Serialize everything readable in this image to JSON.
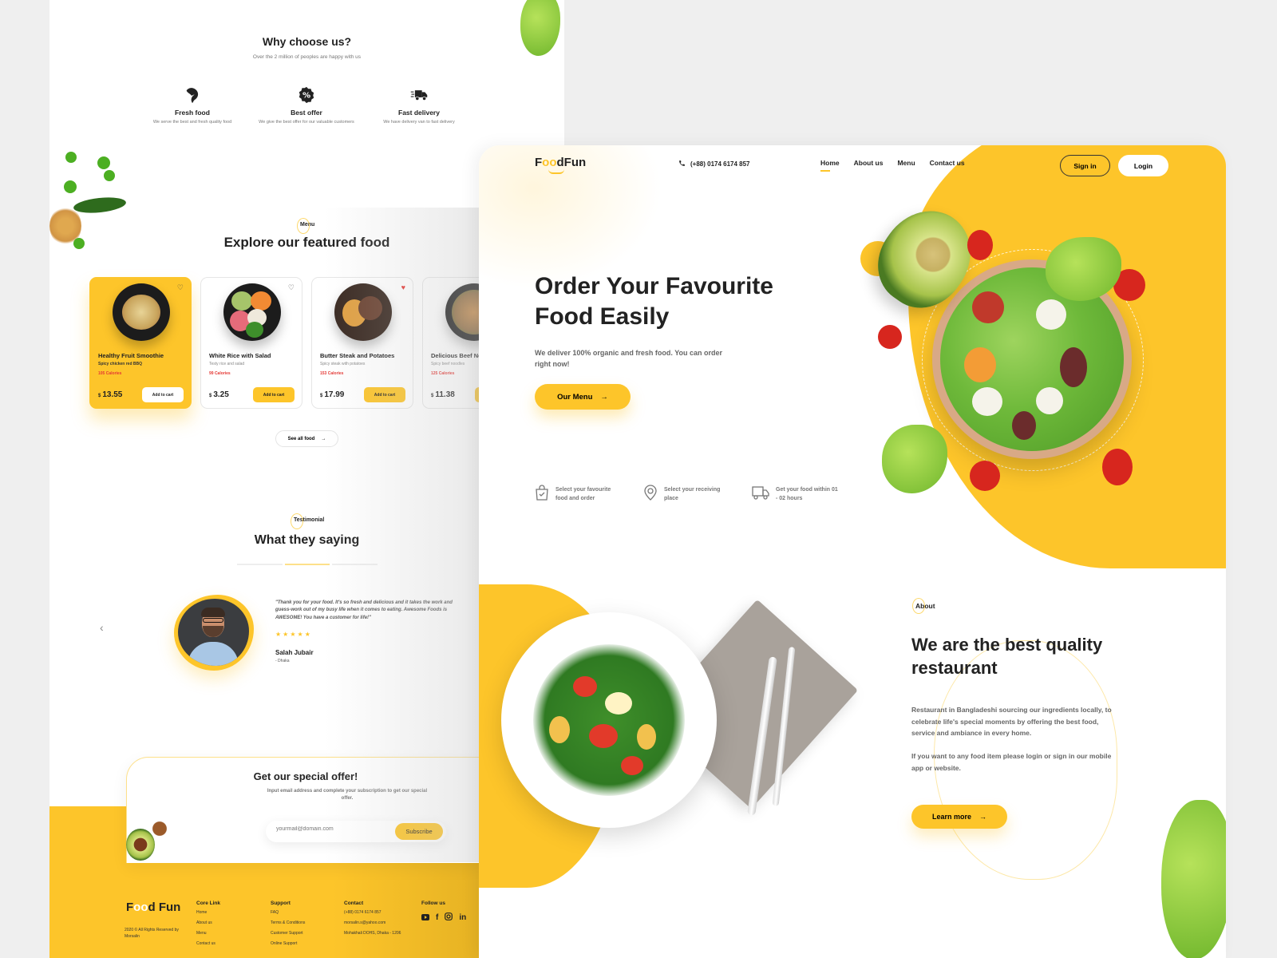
{
  "left_panel": {
    "why": {
      "title": "Why choose us?",
      "subtitle": "Over the 2 million of peoples are happy with us",
      "features": [
        {
          "icon": "broccoli-icon",
          "title": "Fresh food",
          "desc": "We serve the best and fresh quality food"
        },
        {
          "icon": "discount-badge-icon",
          "title": "Best offer",
          "desc": "We give the best offer for our valuable customers"
        },
        {
          "icon": "delivery-truck-icon",
          "title": "Fast delivery",
          "desc": "We have delivery van to fast delivery"
        }
      ]
    },
    "menu": {
      "tag": "Menu",
      "title": "Explore our featured food",
      "items": [
        {
          "name": "Healthy Fruit Smoothie",
          "desc": "Spicy chicken red BBQ",
          "calories": "105 Calories",
          "currency": "$",
          "price": "13.55",
          "cta": "Add to cart",
          "favorite": false,
          "active": true
        },
        {
          "name": "White Rice with Salad",
          "desc": "Testy rice and salad",
          "calories": "99 Calories",
          "currency": "$",
          "price": "3.25",
          "cta": "Add to cart",
          "favorite": false,
          "active": false
        },
        {
          "name": "Butter Steak and Potatoes",
          "desc": "Spicy steak with potatoes",
          "calories": "153 Calories",
          "currency": "$",
          "price": "17.99",
          "cta": "Add to cart",
          "favorite": true,
          "active": false
        },
        {
          "name": "Delicious Beef Noodles",
          "desc": "Spicy beef noodles",
          "calories": "125 Calories",
          "currency": "$",
          "price": "11.38",
          "cta": "Add to cart",
          "favorite": false,
          "active": false
        }
      ],
      "see_all": "See all food"
    },
    "testimonial": {
      "tag": "Testimonial",
      "title": "What they saying",
      "quote": "\"Thank you for your food. It's so fresh and delicious and it takes the work and guess-work out of my busy life when it comes to eating. Awesome Foods is AWESOME! You have a customer for life!\"",
      "stars": "★★★★★",
      "rating": 5,
      "name": "Salah Jubair",
      "location": "- Dhaka"
    },
    "offer": {
      "title": "Get our special offer!",
      "subtitle": "Input email address and complete your subscription to get our special offer.",
      "email_placeholder": "yourmail@domain.com",
      "subscribe": "Subscribe"
    },
    "footer": {
      "logo_a": "F",
      "logo_oo": "oo",
      "logo_b": "d",
      "logo_c": "Fun",
      "copyright": "2020 © All Rights Reserved by Morsalin",
      "columns": [
        {
          "title": "Core Link",
          "links": [
            "Home",
            "About us",
            "Menu",
            "Contact us"
          ]
        },
        {
          "title": "Support",
          "links": [
            "FAQ",
            "Terms & Conditions",
            "Customer Support",
            "Online Support"
          ]
        },
        {
          "title": "Contact",
          "links": [
            "(+88) 0174 6174 857",
            "morsalin.s@yahoo.com",
            "Mohakhali DOHS, Dhaka - 1206"
          ]
        }
      ],
      "follow": "Follow us",
      "socials": [
        "youtube-icon",
        "facebook-icon",
        "instagram-icon",
        "linkedin-icon"
      ]
    }
  },
  "right_panel": {
    "logo": {
      "a": "F",
      "oo": "oo",
      "b": "d",
      "c": "Fun"
    },
    "phone": "(+88) 0174 6174 857",
    "nav": [
      {
        "label": "Home",
        "active": true
      },
      {
        "label": "About us",
        "active": false
      },
      {
        "label": "Menu",
        "active": false
      },
      {
        "label": "Contact us",
        "active": false
      }
    ],
    "sign_in": "Sign in",
    "login": "Login",
    "hero": {
      "title_line1": "Order Your Favourite",
      "title_line2": "Food Easily",
      "subtitle": "We deliver 100% organic and fresh food. You can order right now!",
      "cta": "Our Menu"
    },
    "steps": [
      {
        "icon": "shopping-bag-icon",
        "text": "Select your favourite food and order"
      },
      {
        "icon": "location-pin-icon",
        "text": "Select your receiving place"
      },
      {
        "icon": "delivery-truck-icon",
        "text": "Get your food within 01 - 02 hours"
      }
    ],
    "about": {
      "tag": "About",
      "title_line1": "We are the best quality",
      "title_line2": "restaurant",
      "p1": "Restaurant in Bangladeshi sourcing our ingredients locally, to celebrate life's special moments by offering the best food, service and ambiance in every home.",
      "p2": "If you want to any food item please login or sign in our mobile app or website.",
      "cta": "Learn more"
    }
  },
  "colors": {
    "accent": "#fdc52a",
    "calories": "#e53935",
    "text": "#222222",
    "background": "#efefef"
  }
}
